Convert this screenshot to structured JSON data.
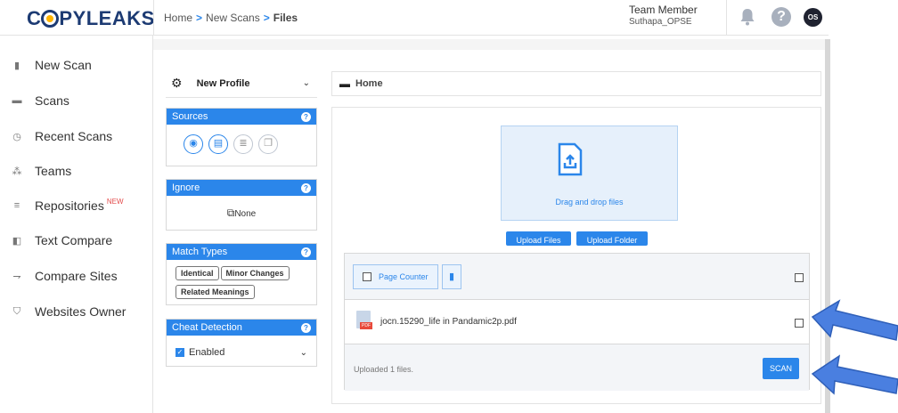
{
  "header": {
    "logo": "COPYLEAKS",
    "logo_rest": "PYLEAKS",
    "logo_first": "C",
    "breadcrumb": [
      "Home",
      "New Scans",
      "Files"
    ],
    "breadcrumb_sep": ">",
    "user_role": "Team Member",
    "user_name": "Suthapa_OPSE",
    "help_label": "?",
    "avatar_initials": "OS"
  },
  "sidebar": {
    "items": [
      {
        "label": "New Scan",
        "icon": "file-plus-icon"
      },
      {
        "label": "Scans",
        "icon": "folder-icon"
      },
      {
        "label": "Recent Scans",
        "icon": "history-icon"
      },
      {
        "label": "Teams",
        "icon": "team-icon"
      },
      {
        "label": "Repositories",
        "icon": "list-icon",
        "badge": "NEW"
      },
      {
        "label": "Text Compare",
        "icon": "compare-icon"
      },
      {
        "label": "Compare Sites",
        "icon": "sites-icon"
      },
      {
        "label": "Websites Owner",
        "icon": "shield-icon"
      }
    ]
  },
  "settings": {
    "profile_label": "New Profile",
    "sources_title": "Sources",
    "ignore_title": "Ignore",
    "ignore_value": "None",
    "match_types_title": "Match Types",
    "match_types": [
      "Identical",
      "Minor Changes",
      "Related Meanings"
    ],
    "cheat_title": "Cheat Detection",
    "cheat_value": "Enabled",
    "help_glyph": "?"
  },
  "files": {
    "path": "Home",
    "drop_text": "Drag and drop files",
    "upload_files": "Upload Files",
    "upload_folder": "Upload Folder",
    "page_counter": "Page Counter",
    "file_name": "jocn.15290_life in Pandamic2p.pdf",
    "status": "Uploaded 1 files.",
    "scan_label": "SCAN"
  },
  "colors": {
    "accent": "#2b86ea",
    "logo": "#1d3b73",
    "arrow_fill": "#4a7fe0"
  }
}
